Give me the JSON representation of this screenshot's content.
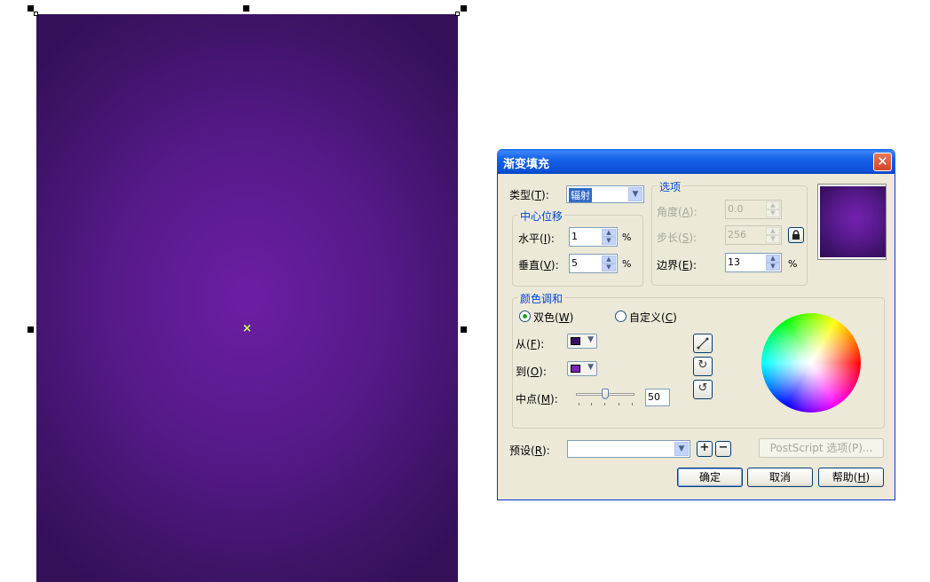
{
  "dialog": {
    "title": "渐变填充",
    "close_icon": "close-icon"
  },
  "type": {
    "label": "类型(",
    "key": "T",
    "suffix": "):",
    "value": "辐射"
  },
  "center_offset": {
    "title": "中心位移",
    "horizontal": {
      "label": "水平(",
      "key": "I",
      "suffix": "):",
      "value": "1",
      "unit": "%"
    },
    "vertical": {
      "label": "垂直(",
      "key": "V",
      "suffix": "):",
      "value": "5",
      "unit": "%"
    }
  },
  "options": {
    "title": "选项",
    "angle": {
      "label": "角度(",
      "key": "A",
      "suffix": "):",
      "value": "0.0"
    },
    "steps": {
      "label": "步长(",
      "key": "S",
      "suffix": "):",
      "value": "256"
    },
    "edge": {
      "label": "边界(",
      "key": "E",
      "suffix": "):",
      "value": "13",
      "unit": "%"
    }
  },
  "color_blend": {
    "title": "颜色调和",
    "two_color": {
      "label": "双色(",
      "key": "W",
      "suffix": ")",
      "selected": true
    },
    "custom": {
      "label": "自定义(",
      "key": "C",
      "suffix": ")",
      "selected": false
    },
    "from": {
      "label": "从(",
      "key": "F",
      "suffix": "):",
      "color": "#3a1060"
    },
    "to": {
      "label": "到(",
      "key": "O",
      "suffix": "):",
      "color": "#7a25b8"
    },
    "midpoint": {
      "label": "中点(",
      "key": "M",
      "suffix": "):",
      "value": "50",
      "slider_fraction": 0.5
    }
  },
  "presets": {
    "label": "预设(",
    "key": "R",
    "suffix": "):",
    "value": ""
  },
  "buttons": {
    "postscript": "PostScript 选项(P)...",
    "ok": "确定",
    "cancel": "取消",
    "help": {
      "label": "帮助(",
      "key": "H",
      "suffix": ")"
    }
  },
  "colors": {
    "canvas_center": "#6c1ea3",
    "canvas_edge": "#341058",
    "accent": "#0046d5"
  }
}
